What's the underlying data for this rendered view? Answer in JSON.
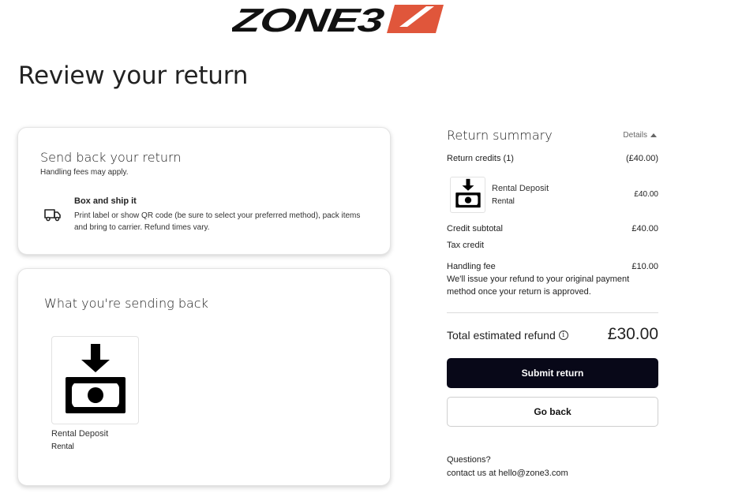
{
  "brand": {
    "logo_text": "ZONE3",
    "accent_color": "#e0563b"
  },
  "page": {
    "title": "Review your return"
  },
  "shipping_card": {
    "title": "Send back your return",
    "subtitle": "Handling fees may apply.",
    "method": {
      "icon": "truck-icon",
      "title": "Box and ship it",
      "description": "Print label or show QR code (be sure to select your preferred method), pack items and bring to carrier. Refund times vary."
    }
  },
  "items_card": {
    "title": "What you're sending back",
    "items": [
      {
        "icon": "cash-deposit-icon",
        "name": "Rental Deposit",
        "type": "Rental"
      }
    ]
  },
  "summary": {
    "title": "Return summary",
    "details_label": "Details",
    "return_credits_label": "Return credits (1)",
    "return_credits_value": "(£40.00)",
    "item": {
      "name": "Rental Deposit",
      "type": "Rental",
      "price": "£40.00"
    },
    "credit_subtotal_label": "Credit subtotal",
    "credit_subtotal_value": "£40.00",
    "tax_credit_label": "Tax credit",
    "handling_fee_label": "Handling fee",
    "handling_fee_value": "£10.00",
    "refund_note": "We'll issue your refund to your original payment method once your return is approved.",
    "total_label": "Total estimated refund",
    "total_value": "£30.00",
    "submit_label": "Submit return",
    "back_label": "Go back",
    "questions_label": "Questions?",
    "contact_text": "contact us at hello@zone3.com",
    "colors": {
      "submit_bg": "#080818"
    }
  }
}
